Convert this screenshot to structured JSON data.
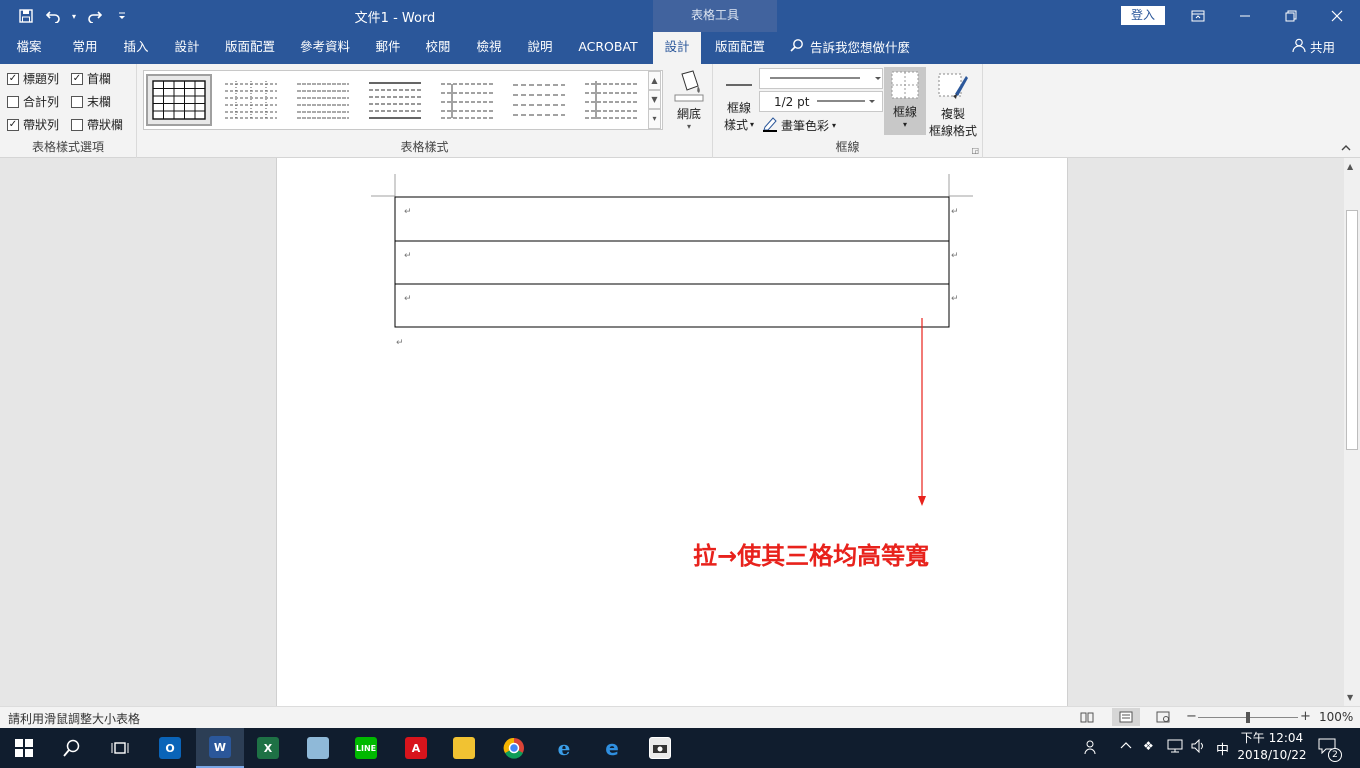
{
  "window": {
    "doc_title": "文件1  -  Word",
    "context_tab_group": "表格工具",
    "signin_label": "登入",
    "colors": {
      "titlebar": "#2b579a",
      "context": "#41639e",
      "annotation": "#e8221c"
    }
  },
  "qat": {
    "save_icon": "save-icon",
    "undo_icon": "undo-icon",
    "redo_icon": "redo-icon",
    "customize_icon": "customize-qat-icon"
  },
  "tabs": [
    {
      "label": "檔案"
    },
    {
      "label": "常用"
    },
    {
      "label": "插入"
    },
    {
      "label": "設計"
    },
    {
      "label": "版面配置"
    },
    {
      "label": "參考資料"
    },
    {
      "label": "郵件"
    },
    {
      "label": "校閱"
    },
    {
      "label": "檢視"
    },
    {
      "label": "說明"
    },
    {
      "label": "ACROBAT"
    },
    {
      "label": "設計",
      "active": true
    },
    {
      "label": "版面配置"
    }
  ],
  "tellme": {
    "label": "告訴我您想做什麼"
  },
  "share": {
    "label": "共用"
  },
  "ribbon": {
    "style_options": {
      "group_label": "表格樣式選項",
      "checkboxes": [
        {
          "label": "標題列",
          "checked": true
        },
        {
          "label": "首欄",
          "checked": true
        },
        {
          "label": "合計列",
          "checked": false
        },
        {
          "label": "末欄",
          "checked": false
        },
        {
          "label": "帶狀列",
          "checked": true
        },
        {
          "label": "帶狀欄",
          "checked": false
        }
      ]
    },
    "table_styles": {
      "group_label": "表格樣式"
    },
    "shading": {
      "label": "網底"
    },
    "borders": {
      "group_label": "框線",
      "border_styles_label1": "框線",
      "border_styles_label2": "樣式",
      "weight": "1/2 pt",
      "pen_color": "畫筆色彩",
      "borders_button": "框線",
      "painter_label1": "複製",
      "painter_label2": "框線格式"
    }
  },
  "document": {
    "annotation": "拉→使其三格均高等寬"
  },
  "status": {
    "message": "請利用滑鼠調整大小表格",
    "zoom": "100%"
  },
  "taskbar": {
    "apps": [
      "start",
      "search",
      "task-view",
      "outlook",
      "word",
      "excel",
      "notepad",
      "line",
      "avira",
      "file-explorer",
      "chrome",
      "ie",
      "edge",
      "camera"
    ],
    "ime": "中",
    "time": "下午 12:04",
    "date": "2018/10/22",
    "notifications": "2"
  }
}
